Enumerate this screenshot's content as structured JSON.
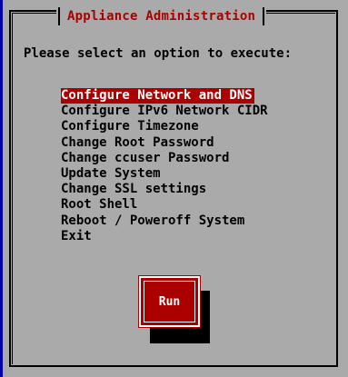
{
  "dialog": {
    "title": "Appliance Administration",
    "prompt": "Please select an option to execute:",
    "menu_items": [
      {
        "label": "Configure Network and DNS",
        "selected": true
      },
      {
        "label": "Configure IPv6 Network CIDR",
        "selected": false
      },
      {
        "label": "Configure Timezone",
        "selected": false
      },
      {
        "label": "Change Root Password",
        "selected": false
      },
      {
        "label": "Change ccuser Password",
        "selected": false
      },
      {
        "label": "Update System",
        "selected": false
      },
      {
        "label": "Change SSL settings",
        "selected": false
      },
      {
        "label": "Root Shell",
        "selected": false
      },
      {
        "label": "Reboot / Poweroff System",
        "selected": false
      },
      {
        "label": "Exit",
        "selected": false
      }
    ],
    "run_label": "Run"
  },
  "colors": {
    "background": "#aaaaaa",
    "accent": "#aa0000",
    "screen": "#0000a8"
  }
}
